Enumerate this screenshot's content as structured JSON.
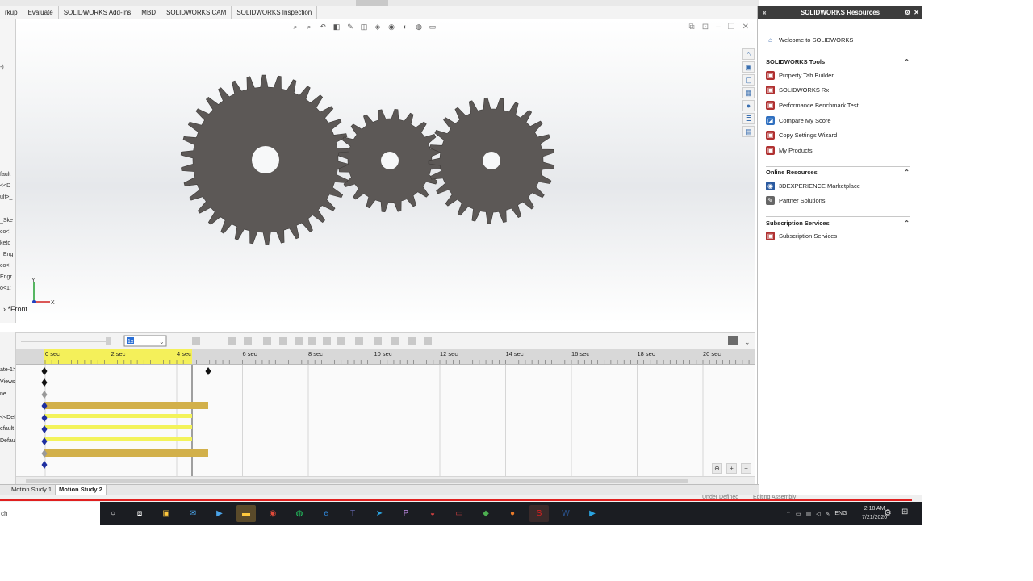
{
  "top_tabs": [
    "rkup",
    "Evaluate",
    "SOLIDWORKS Add-Ins",
    "MBD",
    "SOLIDWORKS CAM",
    "SOLIDWORKS Inspection"
  ],
  "viewport": {
    "view_name": "*Front",
    "axis_x_label": "X",
    "axis_y_label": "Y",
    "hud_icons": [
      "zoom-to-fit-icon",
      "zoom-area-icon",
      "previous-view-icon",
      "section-view-icon",
      "dynamic-annotation-icon",
      "view-orientation-icon",
      "display-style-icon",
      "hide-show-icon",
      "edit-appearance-icon",
      "apply-scene-icon",
      "view-settings-icon"
    ]
  },
  "left_tree_fragments": [
    "-)",
    "fault",
    "<<D",
    "ult>_",
    "_Ske",
    "co<",
    "ketc",
    "_Eng",
    "co<",
    "Engr",
    "o<1:"
  ],
  "resources": {
    "title": "SOLIDWORKS Resources",
    "welcome": "Welcome to SOLIDWORKS",
    "sections": [
      {
        "title": "SOLIDWORKS Tools",
        "items": [
          "Property Tab Builder",
          "SOLIDWORKS Rx",
          "Performance Benchmark Test",
          "Compare My Score",
          "Copy Settings Wizard",
          "My Products"
        ]
      },
      {
        "title": "Online Resources",
        "items": [
          "3DEXPERIENCE Marketplace",
          "Partner Solutions"
        ]
      },
      {
        "title": "Subscription Services",
        "items": [
          "Subscription Services"
        ]
      }
    ]
  },
  "motion": {
    "playback_speed": "1x",
    "time_ticks": [
      "0 sec",
      "2 sec",
      "4 sec",
      "6 sec",
      "8 sec",
      "10 sec",
      "12 sec",
      "14 sec",
      "16 sec",
      "18 sec",
      "20 sec"
    ],
    "tree_fragments": [
      "ate-1>",
      "Views",
      "ne",
      "<<Def",
      "efault",
      "Defau"
    ],
    "study_tabs": [
      "Motion Study 1",
      "Motion Study 2"
    ],
    "active_study": "Motion Study 2"
  },
  "status": {
    "under_defined": "Under Defined",
    "editing": "Editing Assembly"
  },
  "taskbar": {
    "search_text": "ch",
    "language": "ENG",
    "time": "2:18 AM",
    "date": "7/21/2020"
  },
  "colors": {
    "gear": "#5c5856",
    "key_blue": "#1f2fa0",
    "bar_gold": "#d2b04a",
    "bar_yellow": "#f3f35a",
    "header_dark": "#3c3c3c",
    "status_red": "#e0201f"
  }
}
